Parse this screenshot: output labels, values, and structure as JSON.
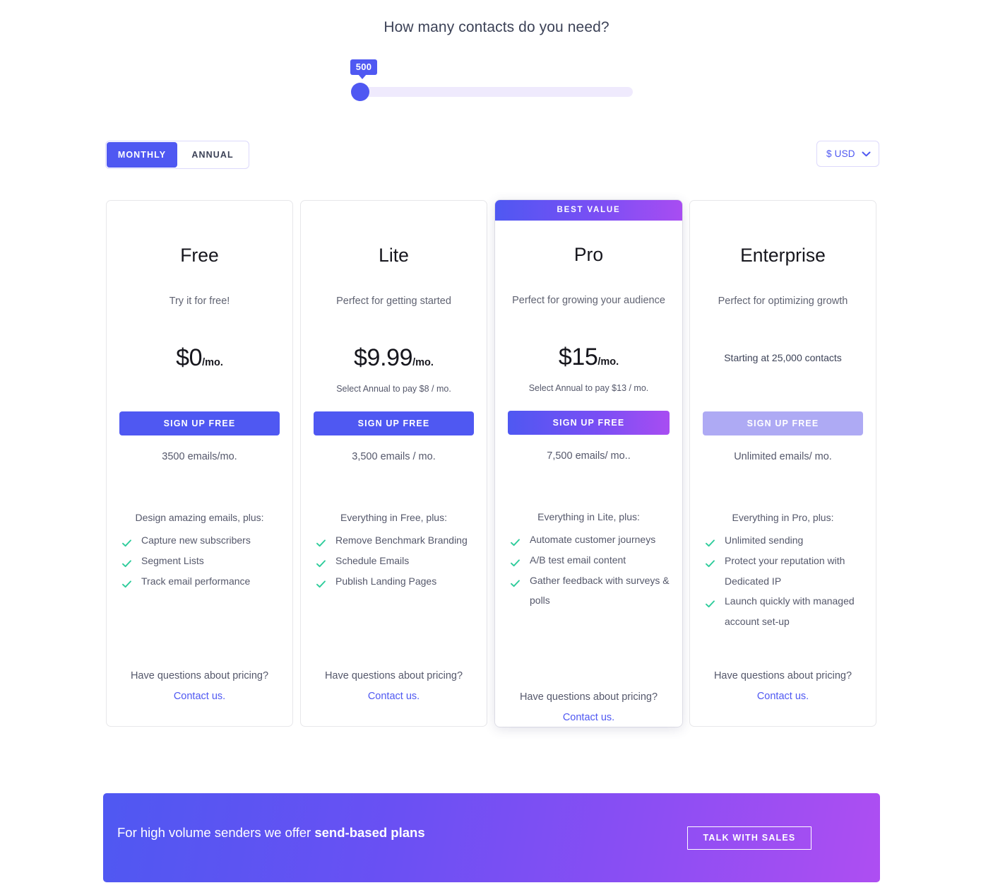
{
  "headline": "How many contacts do you need?",
  "slider": {
    "value_label": "500",
    "min": 500,
    "max": 25000,
    "value": 500,
    "thumb_color": "#4f58f2",
    "track_color": "#efeafd"
  },
  "billing": {
    "options": [
      {
        "label": "MONTHLY",
        "active": true
      },
      {
        "label": "ANNUAL",
        "active": false
      }
    ]
  },
  "currency": {
    "selected": "$ USD",
    "icon": "chevron-down-icon",
    "options": [
      "$ USD"
    ]
  },
  "plans": [
    {
      "badge": null,
      "name": "Free",
      "tagline": "Try it for free!",
      "price": "$0",
      "price_suffix": "/mo.",
      "annual_note": null,
      "starting_note": null,
      "cta": "SIGN UP FREE",
      "cta_style": "solid",
      "emails": "3500 emails/mo.",
      "features_intro": "Design amazing emails, plus:",
      "features": [
        "Capture new subscribers",
        "Segment Lists",
        "Track email performance"
      ],
      "questions": "Have questions about pricing?",
      "contact": "Contact us."
    },
    {
      "badge": null,
      "name": "Lite",
      "tagline": "Perfect for getting started",
      "price": "$9.99",
      "price_suffix": "/mo.",
      "annual_note": "Select Annual to pay $8 / mo.",
      "starting_note": null,
      "cta": "SIGN UP FREE",
      "cta_style": "solid",
      "emails": "3,500 emails / mo.",
      "features_intro": "Everything in Free, plus:",
      "features": [
        "Remove Benchmark Branding",
        "Schedule Emails",
        "Publish Landing Pages"
      ],
      "questions": "Have questions about pricing?",
      "contact": "Contact us."
    },
    {
      "badge": "BEST VALUE",
      "name": "Pro",
      "tagline": "Perfect for growing your audience",
      "price": "$15",
      "price_suffix": "/mo.",
      "annual_note": "Select Annual to pay $13 / mo.",
      "starting_note": null,
      "cta": "SIGN UP FREE",
      "cta_style": "gradient",
      "emails": "7,500 emails/ mo..",
      "features_intro": "Everything in Lite, plus:",
      "features": [
        "Automate customer journeys",
        "A/B test email content",
        "Gather feedback with surveys & polls"
      ],
      "questions": "Have questions about pricing?",
      "contact": "Contact us."
    },
    {
      "badge": null,
      "name": "Enterprise",
      "tagline": "Perfect for optimizing growth",
      "price": null,
      "price_suffix": null,
      "annual_note": null,
      "starting_note": "Starting at 25,000 contacts",
      "cta": "SIGN UP FREE",
      "cta_style": "muted",
      "emails": "Unlimited emails/ mo.",
      "features_intro": "Everything in Pro, plus:",
      "features": [
        "Unlimited sending",
        "Protect your reputation with Dedicated IP",
        "Launch quickly with managed account set-up"
      ],
      "questions": "Have questions about pricing?",
      "contact": "Contact us."
    }
  ],
  "banner": {
    "text_plain": "For high volume senders we offer ",
    "text_bold": "send-based plans",
    "button": "TALK WITH SALES"
  },
  "colors": {
    "brand": "#4f58f2",
    "accent_purple": "#a84df2",
    "check_green": "#2ecc9b",
    "muted_cta": "#aeaaf4",
    "text": "#55586b"
  }
}
